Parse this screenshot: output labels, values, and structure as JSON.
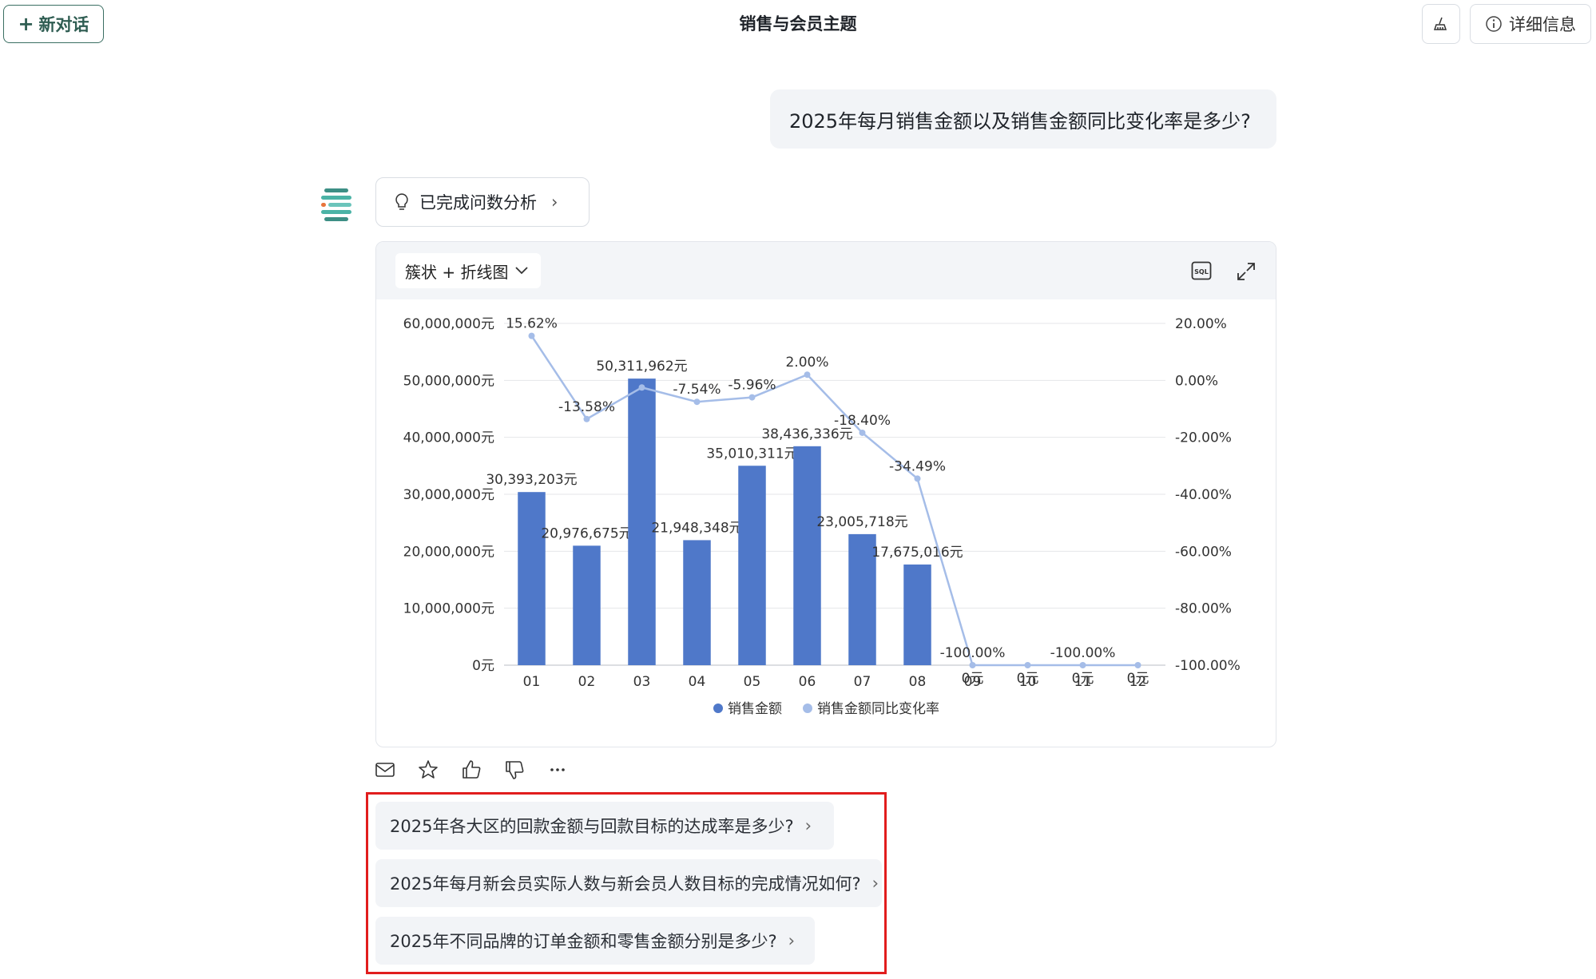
{
  "header": {
    "new_chat_label": "新对话",
    "title": "销售与会员主题",
    "detail_label": "详细信息",
    "icons": {
      "new_chat": "plus-icon",
      "clear": "broom-icon",
      "detail": "info-icon"
    }
  },
  "conversation": {
    "user_message": "2025年每月销售金额以及销售金额同比变化率是多少?",
    "analysis_chip_label": "已完成问数分析"
  },
  "chart_card": {
    "chart_type_label": "簇状 + 折线图",
    "icons": {
      "sql": "sql-icon",
      "expand": "expand-icon"
    }
  },
  "chart_data": {
    "type": "bar",
    "title": "",
    "categories": [
      "01",
      "02",
      "03",
      "04",
      "05",
      "06",
      "07",
      "08",
      "09",
      "10",
      "11",
      "12"
    ],
    "series": [
      {
        "name": "销售金额",
        "type": "bar",
        "axis": "left",
        "color": "#4f78c9",
        "values": [
          30393203,
          20976675,
          50311962,
          21948348,
          35010311,
          38436336,
          23005718,
          17675016,
          0,
          0,
          0,
          0
        ],
        "labels": [
          "30,393,203元",
          "20,976,675元",
          "50,311,962元",
          "21,948,348元",
          "35,010,311元",
          "38,436,336元",
          "23,005,718元",
          "17,675,016元",
          "0元",
          "0元",
          "0元",
          "0元"
        ]
      },
      {
        "name": "销售金额同比变化率",
        "type": "line",
        "axis": "right",
        "color": "#a5bde8",
        "values": [
          15.62,
          -13.58,
          -2.5,
          -7.54,
          -5.96,
          2.0,
          -18.4,
          -34.49,
          -100.0,
          -100.0,
          -100.0,
          -100.0
        ],
        "labels": [
          "15.62%",
          "-13.58%",
          "",
          "-7.54%",
          "-5.96%",
          "2.00%",
          "-18.40%",
          "-34.49%",
          "-100.00%",
          "",
          "-100.00%",
          ""
        ]
      }
    ],
    "y_left": {
      "range": [
        0,
        60000000
      ],
      "ticks": [
        "0元",
        "10,000,000元",
        "20,000,000元",
        "30,000,000元",
        "40,000,000元",
        "50,000,000元",
        "60,000,000元"
      ]
    },
    "y_right": {
      "range": [
        -100,
        20
      ],
      "ticks": [
        "-100.00%",
        "-80.00%",
        "-60.00%",
        "-40.00%",
        "-20.00%",
        "0.00%",
        "20.00%"
      ]
    },
    "grid": true,
    "legend": "bottom-center"
  },
  "toolbar_icons": [
    "mail-icon",
    "star-icon",
    "thumbs-up-icon",
    "thumbs-down-icon",
    "more-icon"
  ],
  "suggestions": [
    "2025年各大区的回款金额与回款目标的达成率是多少?",
    "2025年每月新会员实际人数与新会员人数目标的完成情况如何?",
    "2025年不同品牌的订单金额和零售金额分别是多少?"
  ],
  "colors": {
    "accent": "#2f5d52",
    "bar": "#4f78c9",
    "line": "#a5bde8",
    "highlight": "#e11d1d"
  }
}
